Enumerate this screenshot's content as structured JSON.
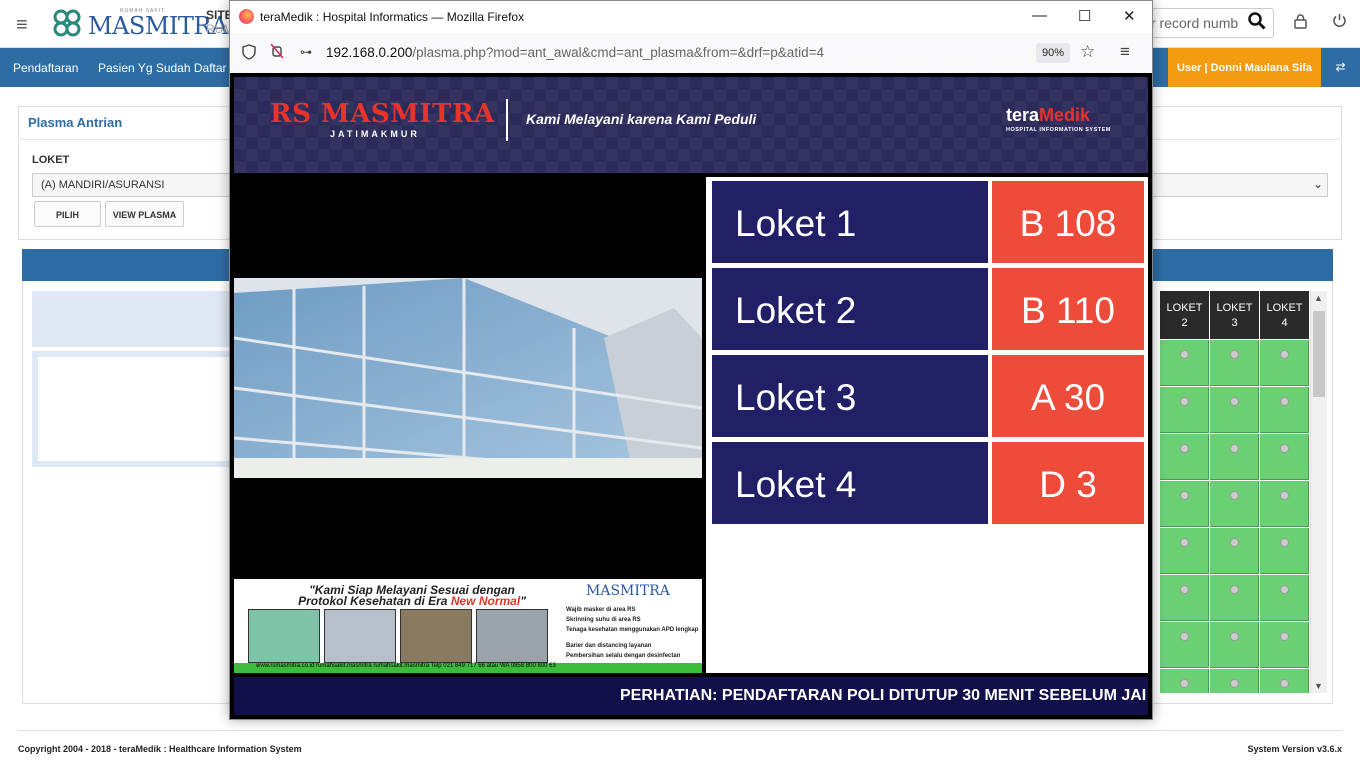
{
  "app": {
    "logo_text": "MASMITRA",
    "logo_sub": "RUMAH SAKIT",
    "site_line1": "SITE",
    "site_line2": "RUM",
    "search_placeholder": "r record numb",
    "nav": [
      "Pendaftaran",
      "Pasien Yg Sudah Daftar"
    ],
    "user_label": "User | Donni Maulana Sifa",
    "panel_title": "Plasma Antrian",
    "loket_label": "LOKET",
    "loket_value": "(A) MANDIRI/ASURANSI",
    "btn_pilih": "PILIH",
    "btn_view": "VIEW PLASMA",
    "grid_headers": [
      "LOKET 2",
      "LOKET 3",
      "LOKET 4"
    ],
    "copyright": "Copyright 2004 - 2018 - teraMedik : Healthcare Information System",
    "version": "System Version v3.6.x"
  },
  "firefox": {
    "title": "teraMedik : Hospital Informatics — Mozilla Firefox",
    "url_host": "192.168.0.200",
    "url_path": "/plasma.php?mod=ant_awal&cmd=ant_plasma&from=&drf=p&atid=4",
    "zoom": "90%"
  },
  "plasma": {
    "hospital_name": "RS MASMITRA",
    "hospital_sub": "JATIMAKMUR",
    "tagline": "Kami Melayani karena Kami Peduli",
    "brand_a": "tera",
    "brand_b": "Medik",
    "brand_sub": "HOSPITAL INFORMATION SYSTEM",
    "promo_line1": "\"Kami Siap Melayani Sesuai dengan",
    "promo_line2": "Protokol Kesehatan di Era ",
    "promo_nn": "New Normal",
    "promo_end": "\"",
    "promo_logo": "MASMITRA",
    "promo_list": [
      "Wajib masker di area RS",
      "Skrinning suhu di area RS",
      "Tenaga kesehatan menggunakan APD lengkap",
      "Barier dan distancing layanan",
      "Pembersihan selalu dengan desinfectan"
    ],
    "promo_footer": "www.rsmasmitra.co.id     rumahsakit.masmitra     rumahsakit.masmitra     Telp 021 849 717 66  atau WA 0858 800 800 63",
    "counters": [
      {
        "name": "Loket 1",
        "number": "B 108"
      },
      {
        "name": "Loket 2",
        "number": "B 110"
      },
      {
        "name": "Loket 3",
        "number": "A 30"
      },
      {
        "name": "Loket 4",
        "number": "D 3"
      }
    ],
    "ticker": "PERHATIAN: PENDAFTARAN POLI DITUTUP 30 MENIT SEBELUM JAI"
  }
}
